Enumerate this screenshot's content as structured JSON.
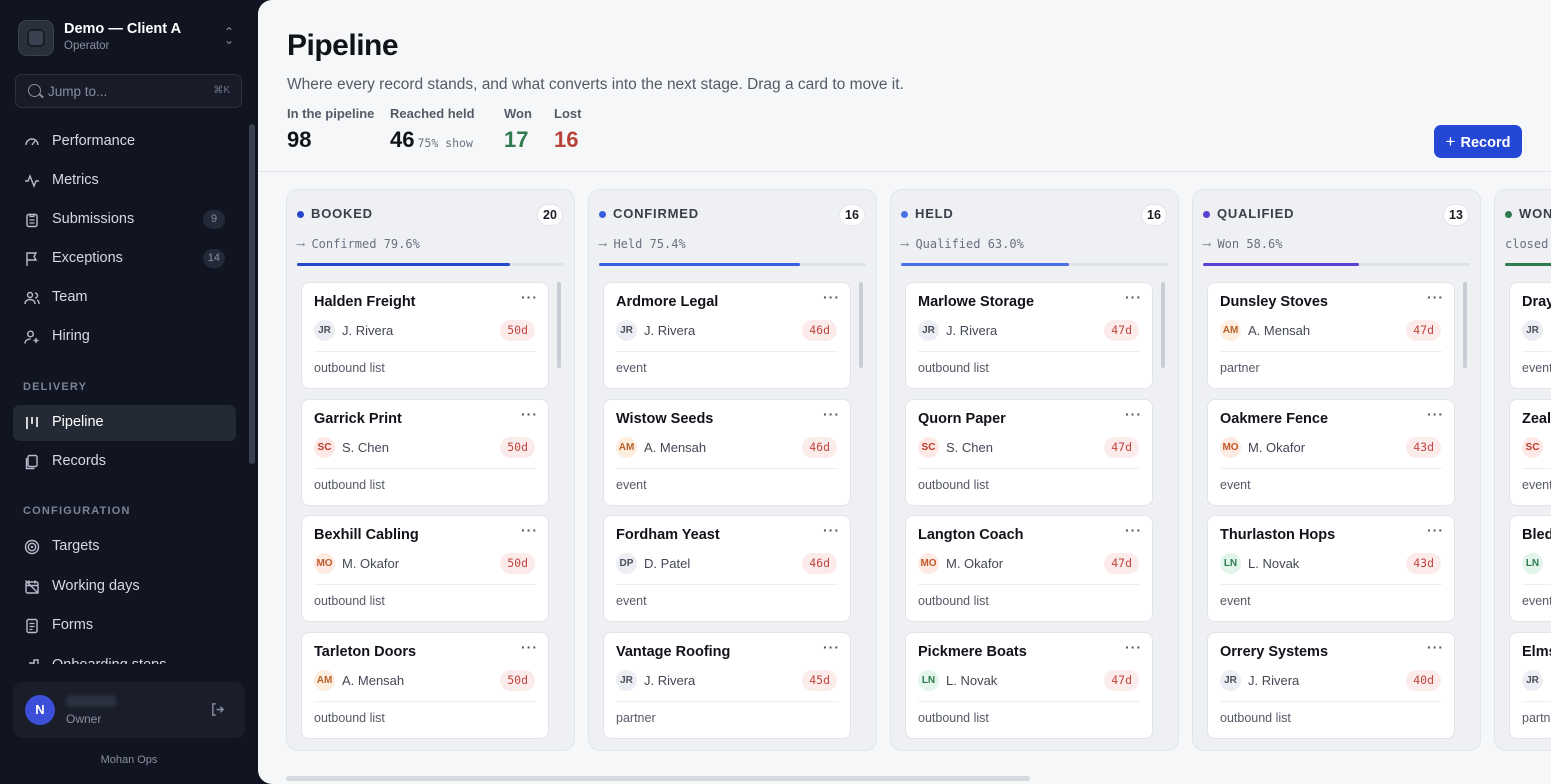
{
  "workspace": {
    "name": "Demo — Client A",
    "role": "Operator"
  },
  "search": {
    "placeholder": "Jump to...",
    "shortcut": "⌘K"
  },
  "nav": {
    "main": [
      {
        "label": "Performance",
        "icon": "gauge-icon"
      },
      {
        "label": "Metrics",
        "icon": "activity-icon"
      },
      {
        "label": "Submissions",
        "icon": "clipboard-icon",
        "count": "9"
      },
      {
        "label": "Exceptions",
        "icon": "flag-icon",
        "count": "14"
      },
      {
        "label": "Team",
        "icon": "users-icon"
      },
      {
        "label": "Hiring",
        "icon": "user-plus-icon"
      }
    ],
    "delivery_label": "DELIVERY",
    "delivery": [
      {
        "label": "Pipeline",
        "icon": "columns-icon",
        "active": true
      },
      {
        "label": "Records",
        "icon": "files-icon"
      }
    ],
    "configuration_label": "CONFIGURATION",
    "configuration": [
      {
        "label": "Targets",
        "icon": "target-icon"
      },
      {
        "label": "Working days",
        "icon": "calendar-off-icon"
      },
      {
        "label": "Forms",
        "icon": "form-icon"
      },
      {
        "label": "Onboarding steps",
        "icon": "steps-icon"
      }
    ]
  },
  "user": {
    "initial": "N",
    "name": "",
    "role": "Owner"
  },
  "footer_brand": "Mohan Ops",
  "page": {
    "title": "Pipeline",
    "subtitle": "Where every record stands, and what converts into the next stage. Drag a card to move it.",
    "stats": {
      "in_pipeline": {
        "label": "In the pipeline",
        "value": "98"
      },
      "reached_held": {
        "label": "Reached held",
        "value": "46",
        "extra": "75% show"
      },
      "won": {
        "label": "Won",
        "value": "17"
      },
      "lost": {
        "label": "Lost",
        "value": "16"
      }
    },
    "record_button": "Record"
  },
  "colors": {
    "accent": "#2447d6",
    "won": "#2f7a4f",
    "lost": "#b8433a"
  },
  "columns": [
    {
      "title": "BOOKED",
      "count": "20",
      "conversion": "Confirmed 79.6%",
      "conversion_value": 0.796,
      "color": "#2547c9",
      "cards": [
        {
          "title": "Halden Freight",
          "initials": "JR",
          "owner": "J. Rivera",
          "age": "50d",
          "source": "outbound list"
        },
        {
          "title": "Garrick Print",
          "initials": "SC",
          "owner": "S. Chen",
          "age": "50d",
          "source": "outbound list"
        },
        {
          "title": "Bexhill Cabling",
          "initials": "MO",
          "owner": "M. Okafor",
          "age": "50d",
          "source": "outbound list"
        },
        {
          "title": "Tarleton Doors",
          "initials": "AM",
          "owner": "A. Mensah",
          "age": "50d",
          "source": "outbound list"
        }
      ]
    },
    {
      "title": "CONFIRMED",
      "count": "16",
      "conversion": "Held 75.4%",
      "conversion_value": 0.754,
      "color": "#3560e0",
      "cards": [
        {
          "title": "Ardmore Legal",
          "initials": "JR",
          "owner": "J. Rivera",
          "age": "46d",
          "source": "event"
        },
        {
          "title": "Wistow Seeds",
          "initials": "AM",
          "owner": "A. Mensah",
          "age": "46d",
          "source": "event"
        },
        {
          "title": "Fordham Yeast",
          "initials": "DP",
          "owner": "D. Patel",
          "age": "46d",
          "source": "event"
        },
        {
          "title": "Vantage Roofing",
          "initials": "JR",
          "owner": "J. Rivera",
          "age": "45d",
          "source": "partner"
        }
      ]
    },
    {
      "title": "HELD",
      "count": "16",
      "conversion": "Qualified 63.0%",
      "conversion_value": 0.63,
      "color": "#4a72e6",
      "cards": [
        {
          "title": "Marlowe Storage",
          "initials": "JR",
          "owner": "J. Rivera",
          "age": "47d",
          "source": "outbound list"
        },
        {
          "title": "Quorn Paper",
          "initials": "SC",
          "owner": "S. Chen",
          "age": "47d",
          "source": "outbound list"
        },
        {
          "title": "Langton Coach",
          "initials": "MO",
          "owner": "M. Okafor",
          "age": "47d",
          "source": "outbound list"
        },
        {
          "title": "Pickmere Boats",
          "initials": "LN",
          "owner": "L. Novak",
          "age": "47d",
          "source": "outbound list"
        }
      ]
    },
    {
      "title": "QUALIFIED",
      "count": "13",
      "conversion": "Won 58.6%",
      "conversion_value": 0.586,
      "color": "#5b3fd0",
      "cards": [
        {
          "title": "Dunsley Stoves",
          "initials": "AM",
          "owner": "A. Mensah",
          "age": "47d",
          "source": "partner"
        },
        {
          "title": "Oakmere Fence",
          "initials": "MO",
          "owner": "M. Okafor",
          "age": "43d",
          "source": "event"
        },
        {
          "title": "Thurlaston Hops",
          "initials": "LN",
          "owner": "L. Novak",
          "age": "43d",
          "source": "event"
        },
        {
          "title": "Orrery Systems",
          "initials": "JR",
          "owner": "J. Rivera",
          "age": "40d",
          "source": "outbound list"
        }
      ]
    },
    {
      "title": "WON",
      "count": "",
      "conversion": "closed",
      "conversion_value": 1,
      "color": "#2f7a4f",
      "cards": [
        {
          "title": "Dray",
          "initials": "JR",
          "owner": "",
          "age": "",
          "source": "event"
        },
        {
          "title": "Zeals",
          "initials": "SC",
          "owner": "",
          "age": "",
          "source": "event"
        },
        {
          "title": "Bled",
          "initials": "LN",
          "owner": "",
          "age": "",
          "source": "event"
        },
        {
          "title": "Elms",
          "initials": "JR",
          "owner": "",
          "age": "",
          "source": "partn"
        }
      ]
    }
  ],
  "initial_colors": {
    "JR": {
      "bg": "#eceef3",
      "fg": "#4a4f5c"
    },
    "SC": {
      "bg": "#fde8e6",
      "fg": "#c0392b"
    },
    "MO": {
      "bg": "#fdebe3",
      "fg": "#c2572b"
    },
    "AM": {
      "bg": "#fdeee0",
      "fg": "#b9622a"
    },
    "DP": {
      "bg": "#eceef3",
      "fg": "#4a4f5c"
    },
    "LN": {
      "bg": "#e3f4ea",
      "fg": "#2f7a4f"
    }
  }
}
